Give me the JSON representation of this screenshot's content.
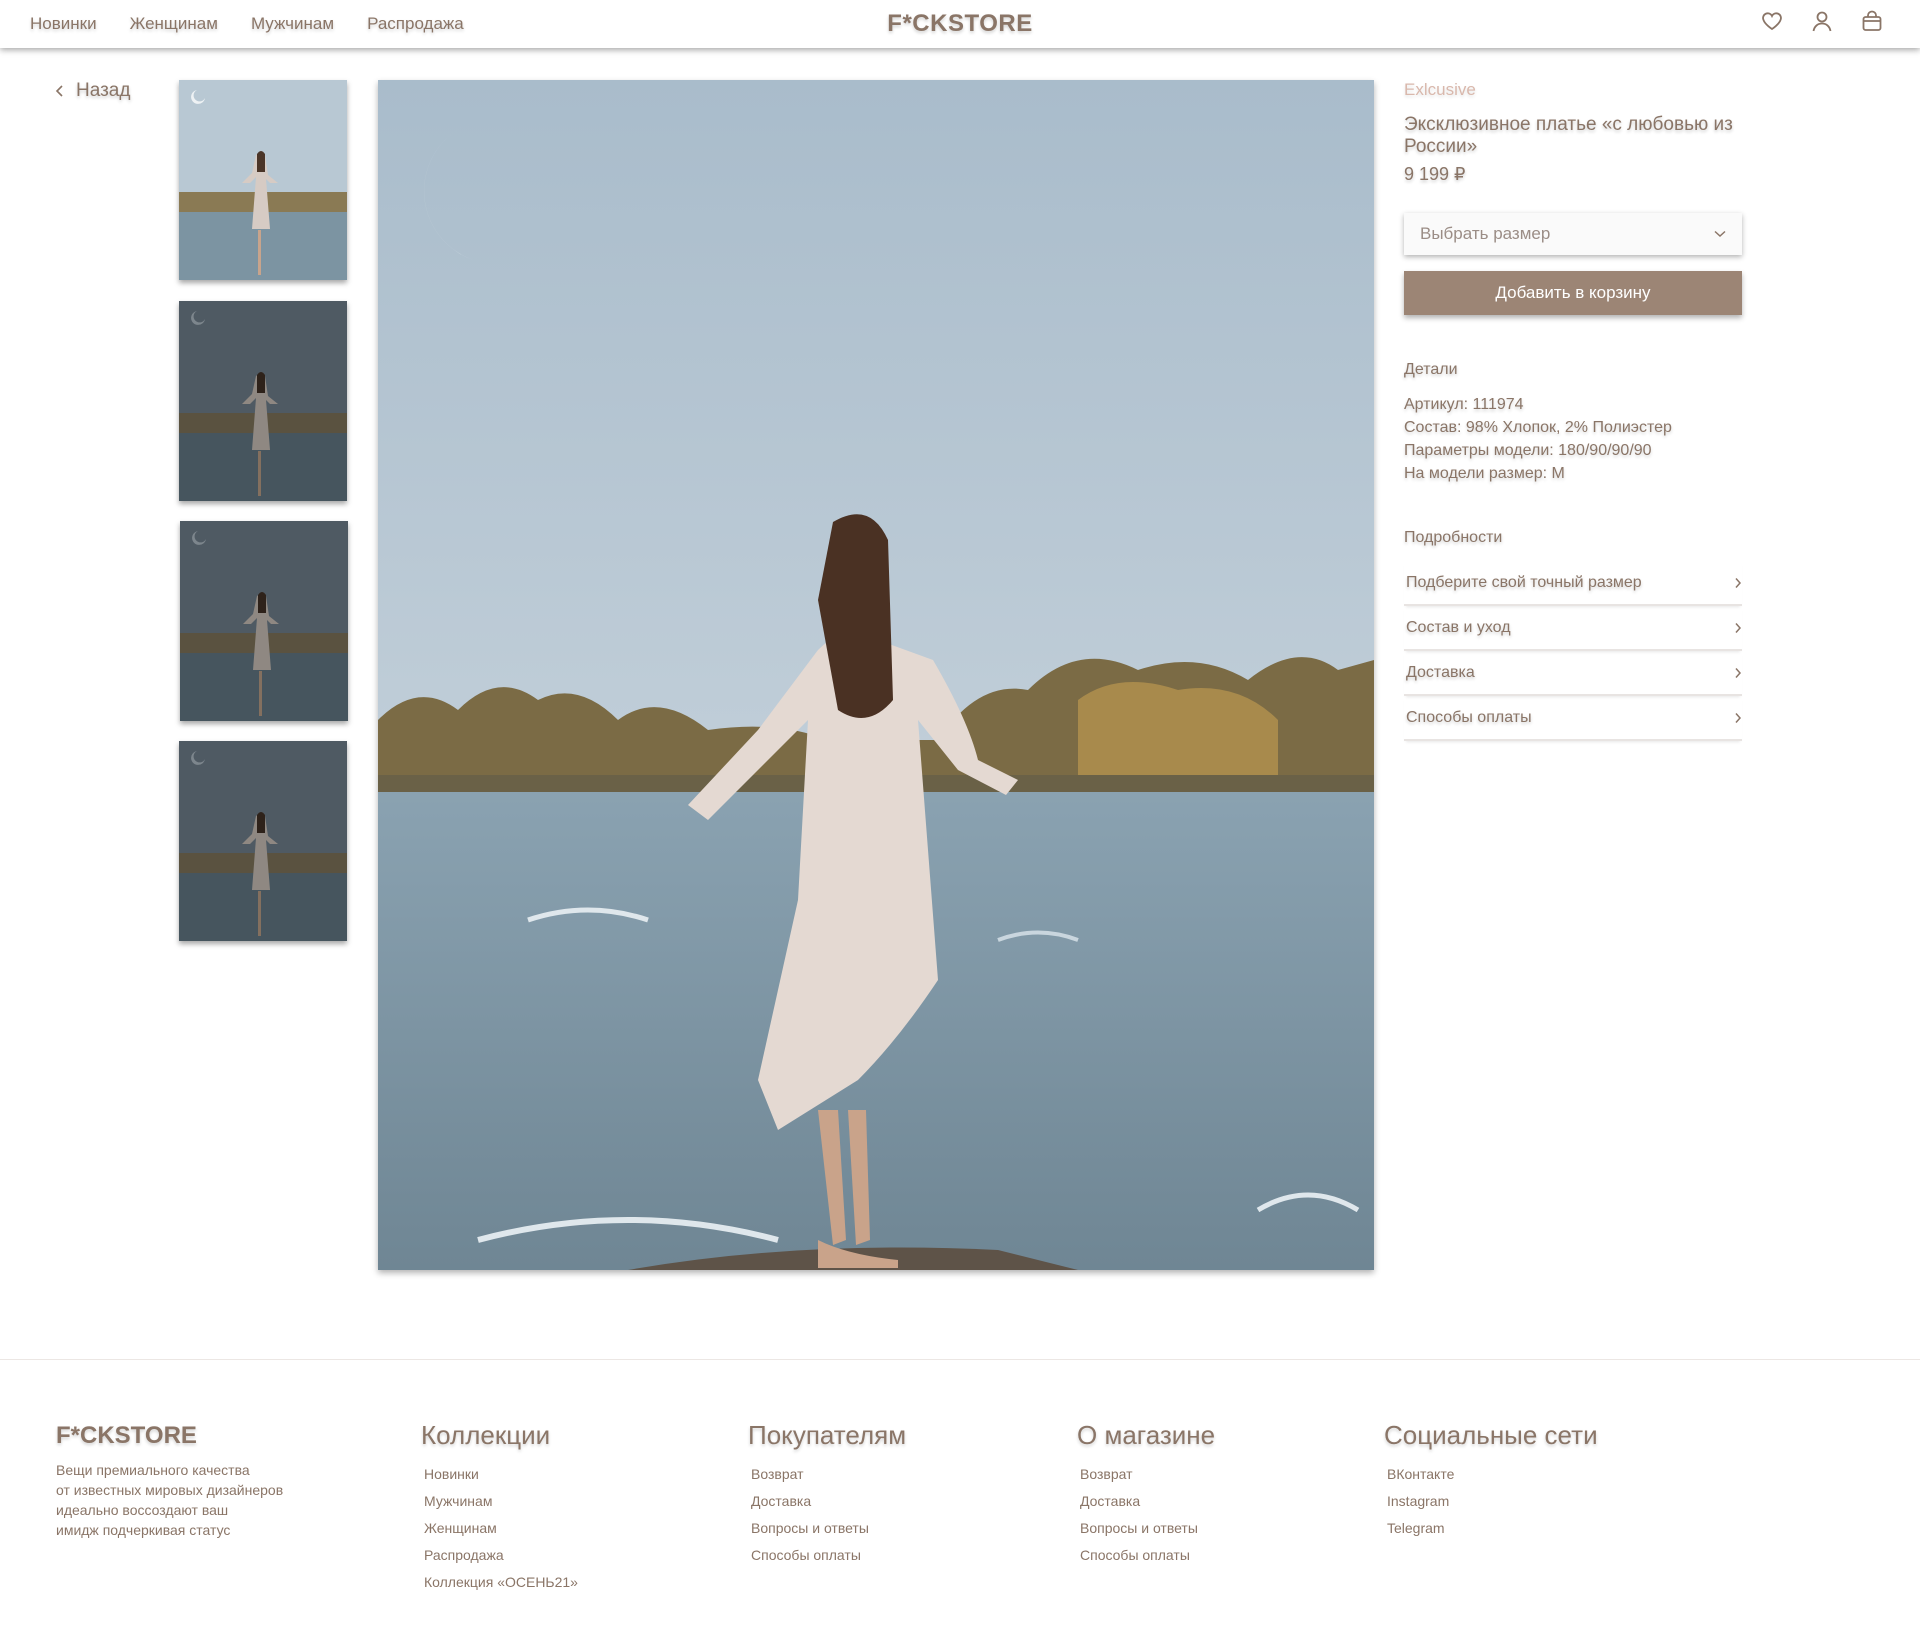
{
  "header": {
    "nav": [
      "Новинки",
      "Женщинам",
      "Мужчинам",
      "Распродажа"
    ],
    "logo": "F*CKSTORE",
    "icons": [
      "heart-icon",
      "user-icon",
      "bag-icon"
    ]
  },
  "back_label": "Назад",
  "product": {
    "brand": "Exlcusive",
    "title": "Эксклюзивное платье «с любовью из России»",
    "price": "9 199 ₽",
    "size_placeholder": "Выбрать размер",
    "add_to_cart": "Добавить в корзину",
    "details_heading": "Детали",
    "details": [
      "Артикул: 111974",
      "Состав: 98% Хлопок, 2% Полиэстер",
      "Параметры модели: 180/90/90/90",
      "На модели размер: M"
    ],
    "more_heading": "Подробности",
    "accordion": [
      "Подберите свой точный размер",
      "Состав и уход",
      "Доставка",
      "Способы оплаты"
    ]
  },
  "footer": {
    "logo": "F*CKSTORE",
    "description": [
      "Вещи премиального качества",
      "от известных мировых дизайнеров",
      "идеально воссоздают ваш",
      "имидж подчеркивая статус"
    ],
    "columns": [
      {
        "title": "Коллекции",
        "links": [
          "Новинки",
          "Мужчинам",
          "Женщинам",
          "Распродажа",
          "Коллекция «ОСЕНЬ21»"
        ]
      },
      {
        "title": "Покупателям",
        "links": [
          "Возврат",
          "Доставка",
          "Вопросы и ответы",
          "Способы оплаты"
        ]
      },
      {
        "title": "О магазине",
        "links": [
          "Возврат",
          "Доставка",
          "Вопросы и ответы",
          "Способы оплаты"
        ]
      },
      {
        "title": "Социальные сети",
        "links": [
          "ВКонтакте",
          "Instagram",
          "Telegram"
        ]
      }
    ]
  },
  "colors": {
    "text": "#8a7567",
    "accent_button": "#9c8575",
    "brand_label": "#d9b8ac"
  }
}
